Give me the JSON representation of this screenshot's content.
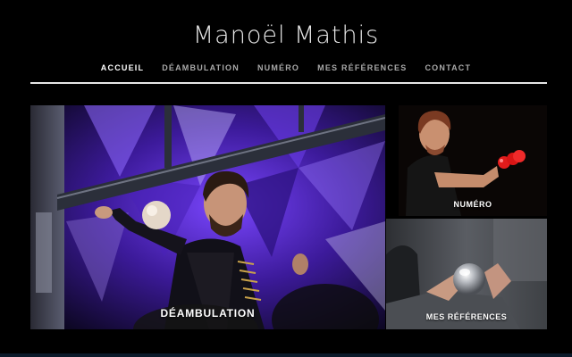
{
  "header": {
    "site_title": "Manoël Mathis"
  },
  "nav": {
    "items": [
      {
        "label": "ACCUEIL",
        "active": true
      },
      {
        "label": "DÉAMBULATION",
        "active": false
      },
      {
        "label": "NUMÉRO",
        "active": false
      },
      {
        "label": "MES RÉFÉRENCES",
        "active": false
      },
      {
        "label": "CONTACT",
        "active": false
      }
    ]
  },
  "tiles": {
    "hero": {
      "label": "DÉAMBULATION"
    },
    "top_right": {
      "label": "NUMÉRO"
    },
    "bottom_right": {
      "label": "MES RÉFÉRENCES"
    }
  },
  "colors": {
    "background": "#000000",
    "nav_active": "#ffffff",
    "nav_inactive": "#a9a9a9",
    "accent_purple": "#5b2fc9"
  }
}
